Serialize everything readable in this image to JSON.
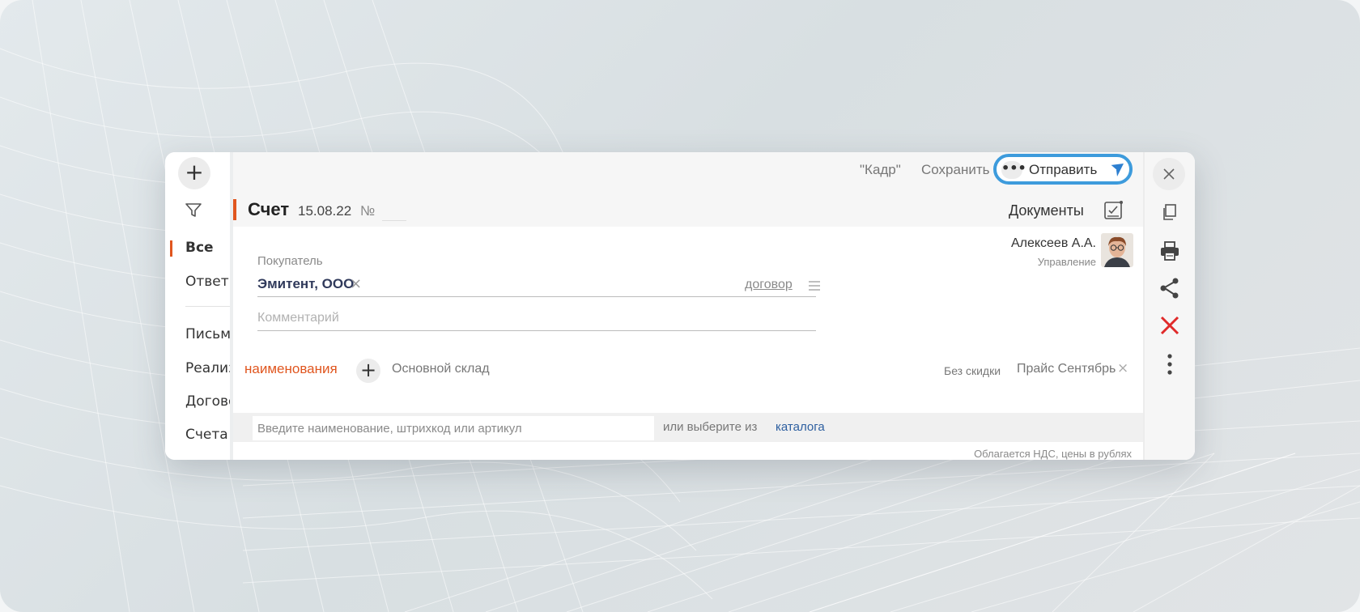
{
  "toolbar": {
    "frame_label": "\"Кадр\"",
    "save_label": "Сохранить",
    "more_label": "•••",
    "send_label": "Отправить"
  },
  "nav": {
    "add_label": "+",
    "items": [
      "Все",
      "Ответы",
      "Письма",
      "Реализа",
      "Договор",
      "Счета"
    ]
  },
  "document": {
    "type": "Счет",
    "date": "15.08.22",
    "number_label": "№",
    "documents_link": "Документы"
  },
  "buyer": {
    "label": "Покупатель",
    "value": "Эмитент, ООО",
    "contract_link": "договор"
  },
  "comment": {
    "placeholder": "Комментарий"
  },
  "user": {
    "name": "Алексеев А.А.",
    "department": "Управление"
  },
  "items": {
    "tab_label": "наименования",
    "warehouse": "Основной склад",
    "discount": "Без скидки",
    "price_list": "Прайс Сентябрь",
    "search_placeholder": "Введите наименование, штрихкод или артикул",
    "or_text": "или выберите из",
    "catalog_link": "каталога",
    "vat_note": "Облагается НДС, цены в рублях"
  },
  "icons": {
    "filter": "filter-icon",
    "send": "paper-plane-icon",
    "documents": "document-signature-icon",
    "close": "close-icon",
    "copy": "copy-icon",
    "print": "printer-icon",
    "share": "share-icon",
    "delete": "delete-icon",
    "more": "more-vertical-icon"
  },
  "colors": {
    "accent": "#e0561f",
    "highlight": "#3d9bdc",
    "link": "#2d5fa0",
    "delete": "#e02a2a"
  }
}
